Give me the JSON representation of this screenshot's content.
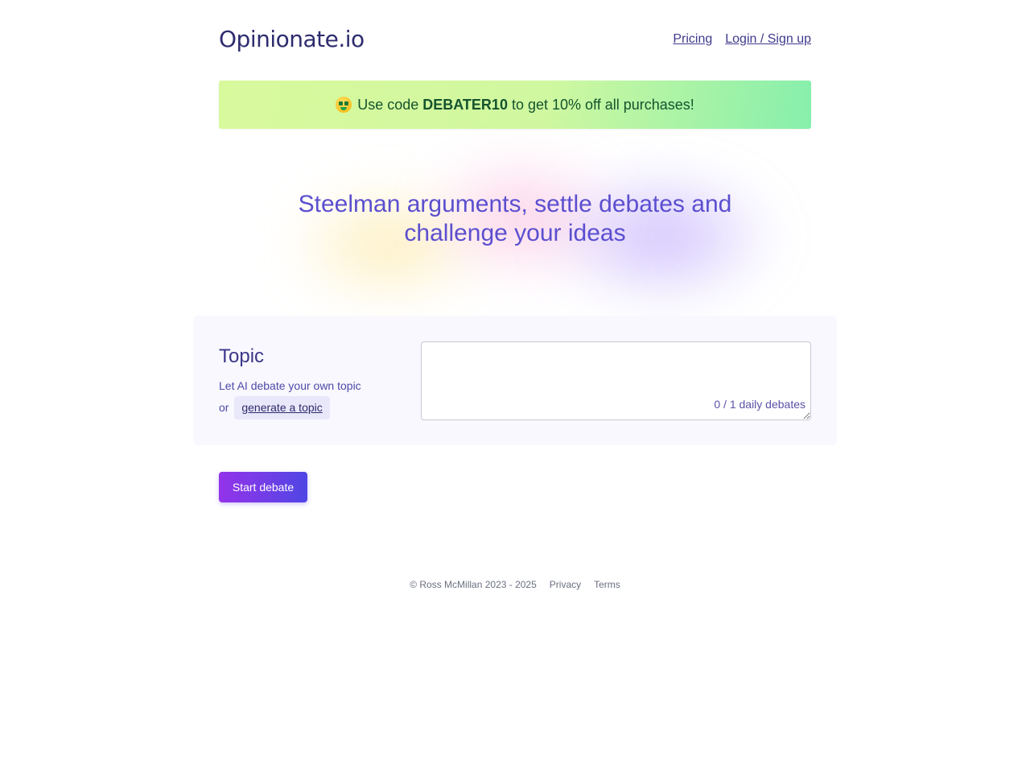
{
  "header": {
    "logo": "Opinionate.io",
    "nav": [
      {
        "label": "Pricing"
      },
      {
        "label": "Login / Sign up"
      }
    ]
  },
  "promo": {
    "emoji": "money-mouth-face-icon",
    "prefix": "Use code",
    "code": "DEBATER10",
    "suffix": "to get 10% off all purchases!"
  },
  "hero": {
    "headline_line1": "Steelman arguments, settle debates and",
    "headline_line2": "challenge your ideas"
  },
  "topic": {
    "title": "Topic",
    "description": "Let AI debate your own topic",
    "or_label": "or",
    "generate_link": "generate a topic",
    "input_value": "",
    "counter": "0 / 1 daily debates"
  },
  "actions": {
    "start_label": "Start debate"
  },
  "footer": {
    "copyright": "© Ross McMillan 2023 - 2025",
    "links": [
      {
        "label": "Privacy"
      },
      {
        "label": "Terms"
      }
    ]
  },
  "colors": {
    "brand": "#2e2c6f",
    "accent": "#5b4fcf",
    "button_start": "#9333ea",
    "button_end": "#4f46e5",
    "promo_bg": "#d9f99d"
  }
}
